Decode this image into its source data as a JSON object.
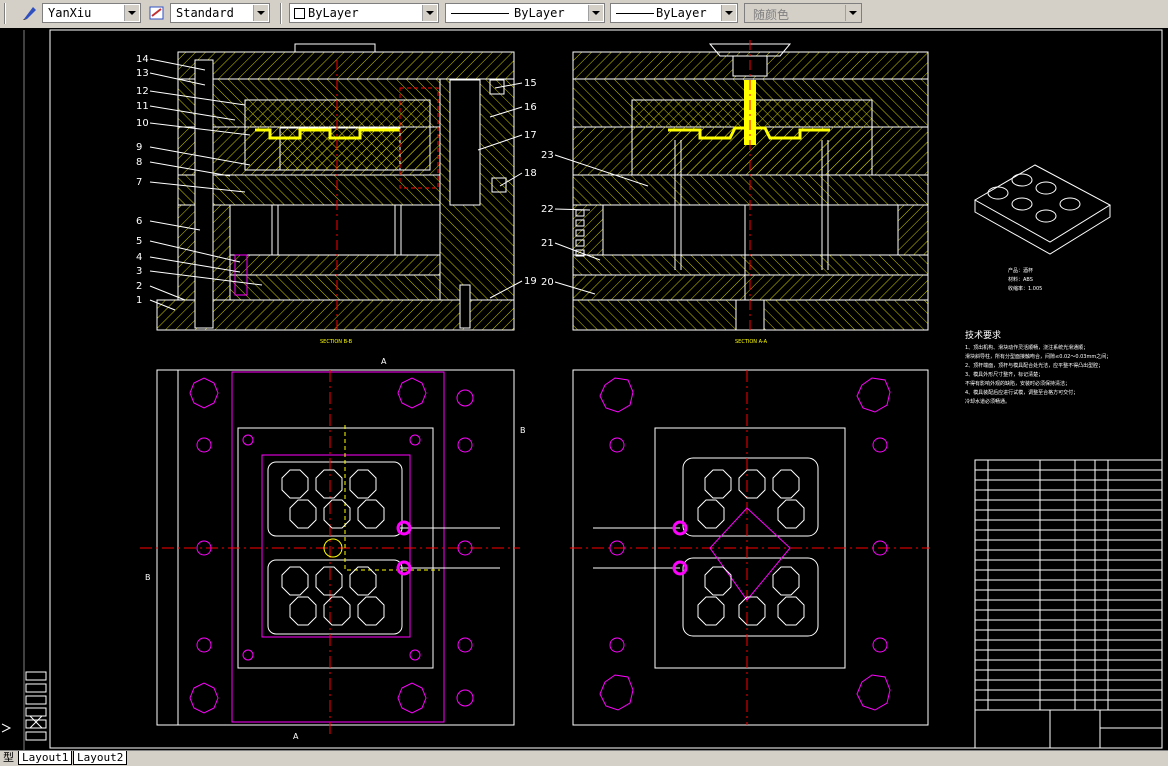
{
  "toolbar": {
    "text_style": "YanXiu",
    "dim_style": "Standard",
    "layer_color": "ByLayer",
    "linetype": "ByLayer",
    "lineweight": "ByLayer",
    "plot_style": "随颜色"
  },
  "drawing": {
    "section_left_label": "SECTION B-B",
    "section_right_label": "SECTION A-A",
    "part_numbers_left": [
      "14",
      "13",
      "12",
      "11",
      "10",
      "9",
      "8",
      "7",
      "6",
      "5",
      "4",
      "3",
      "2",
      "1"
    ],
    "part_numbers_right_left": [
      "15",
      "16",
      "17",
      "18",
      "19"
    ],
    "part_numbers_right_view": [
      "23",
      "22",
      "21",
      "20"
    ],
    "section_marks": [
      "A",
      "A",
      "B",
      "B"
    ],
    "part_info": [
      "产品：酒杯",
      "材料：ABS",
      "收缩率：1.005"
    ],
    "tech_title": "技术要求",
    "tech_notes": [
      "1、顶出机构、滑块动作灵活顺畅，浇注系统光滑通顺；",
      "滑块斜导柱，所有分型面接触吻合，间隙≤0.02～0.03mm之间；",
      "2、顶杆端面，顶杆与模具配合处光洁，应平整不得凸出型腔；",
      "3、模具外形尺寸整齐，标记清楚；",
      "不得有影响外观的缺陷，安装时必须保持清洁；",
      "4、模具装配后应进行试模，调整至合格方可交付；",
      "冷却水道必须畅通。"
    ]
  },
  "colors": {
    "accent_yellow": "#ffff00",
    "magenta": "#ff00ff",
    "red": "#ff0000",
    "white": "#ffffff",
    "toolbar_bg": "#d4d0c8"
  },
  "tabs": [
    "型",
    "Layout1",
    "Layout2"
  ]
}
